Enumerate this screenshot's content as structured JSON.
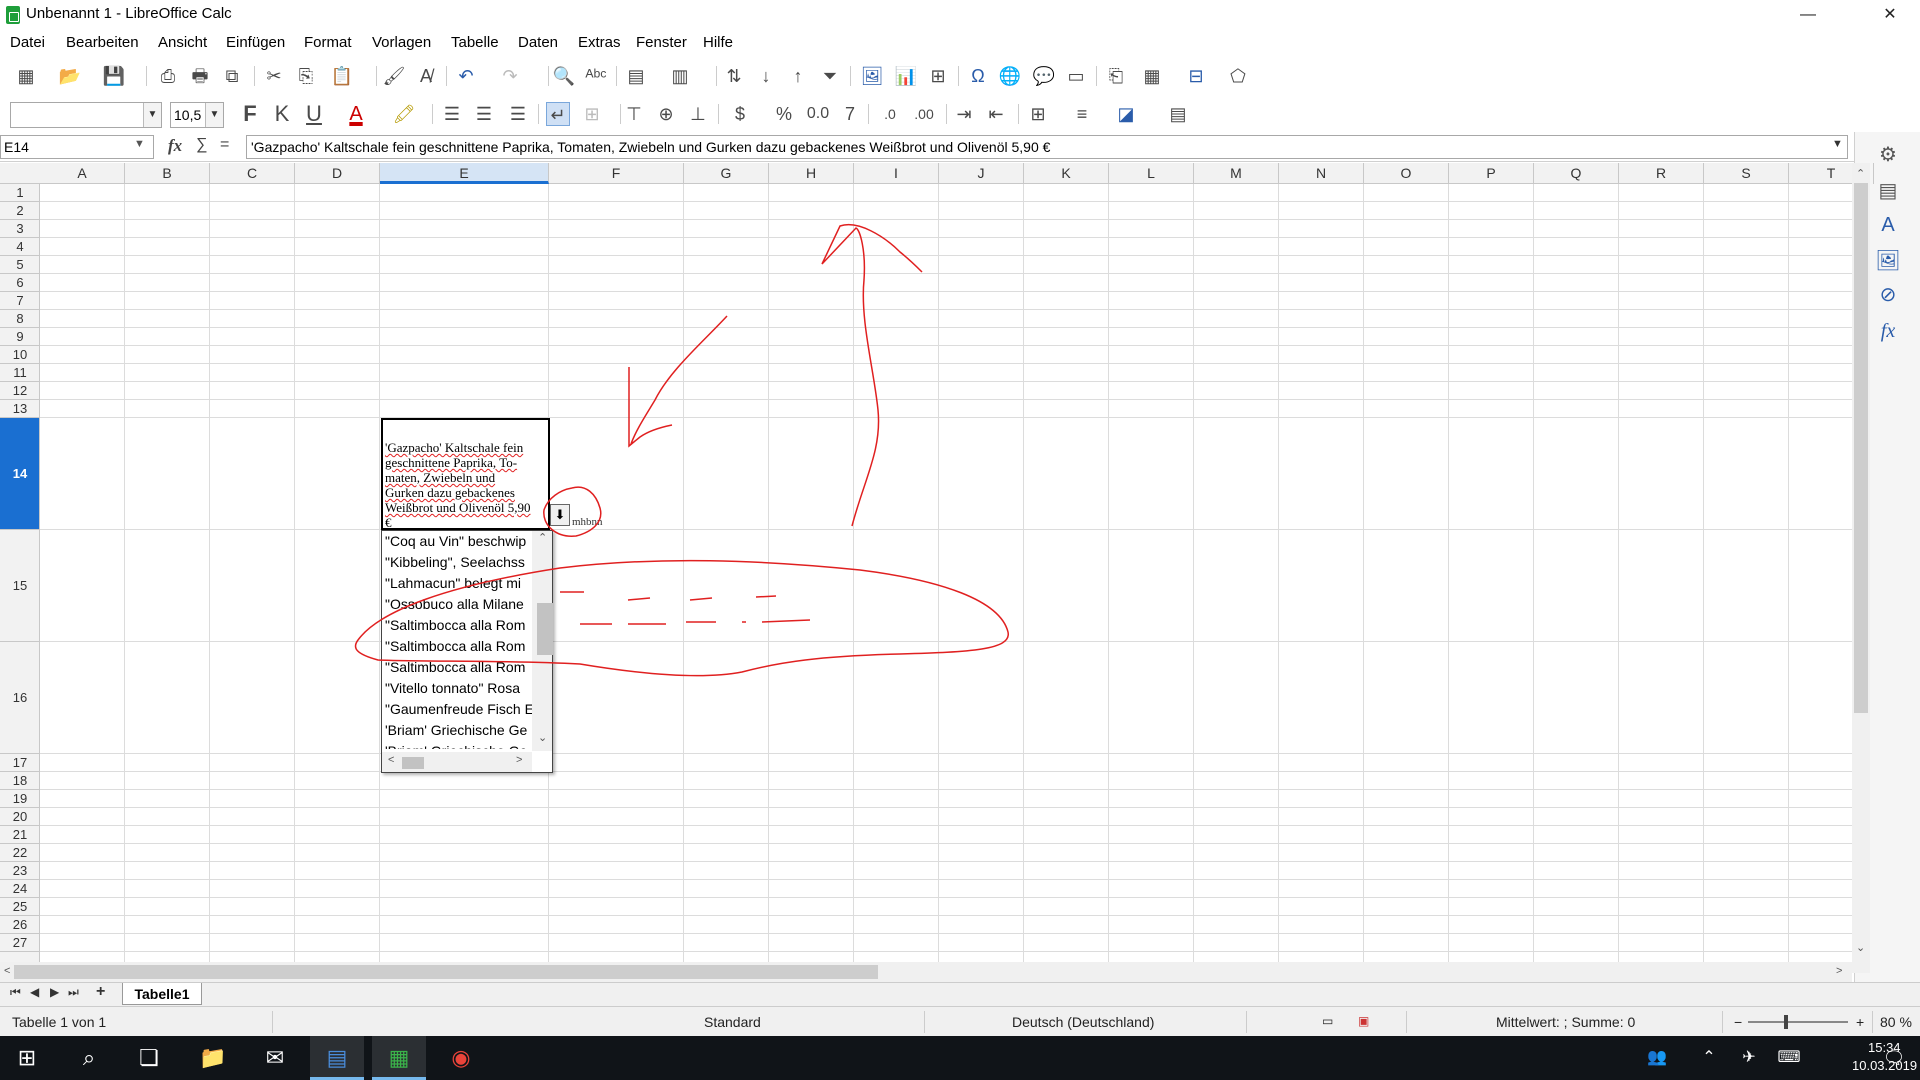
{
  "window": {
    "title": "Unbenannt 1 - LibreOffice Calc",
    "controls": [
      "—",
      "❐",
      "✕"
    ]
  },
  "menu": [
    "Datei",
    "Bearbeiten",
    "Ansicht",
    "Einfügen",
    "Format",
    "Vorlagen",
    "Tabelle",
    "Daten",
    "Extras",
    "Fenster",
    "Hilfe"
  ],
  "format_toolbar": {
    "font_name": "",
    "font_size": "10,5",
    "bold": "F",
    "italic": "K",
    "underline": "U",
    "currency": "$",
    "percent": "%",
    "number": "0.0",
    "decimals_add": ".0",
    "decimals_del": ".00"
  },
  "formula_bar": {
    "name_box": "E14",
    "fx": "fx",
    "sum": "∑",
    "equals": "=",
    "content": "'Gazpacho' Kaltschale fein geschnittene Paprika, Tomaten, Zwiebeln und Gurken dazu gebackenes Weißbrot und Olivenöl         5,90 €"
  },
  "columns": [
    "A",
    "B",
    "C",
    "D",
    "E",
    "F",
    "G",
    "H",
    "I",
    "J",
    "K",
    "L",
    "M",
    "N",
    "O",
    "P",
    "Q",
    "R",
    "S",
    "T"
  ],
  "selected_column": "E",
  "rows": [
    "1",
    "2",
    "3",
    "4",
    "5",
    "6",
    "7",
    "8",
    "9",
    "10",
    "11",
    "12",
    "13",
    "14",
    "15",
    "16",
    "17",
    "18",
    "19",
    "20",
    "21",
    "22",
    "23",
    "24",
    "25",
    "26",
    "27"
  ],
  "selected_row": "14",
  "active_cell": {
    "lines": [
      "'Gazpacho' Kaltschale fein",
      "geschnittene Paprika, To-",
      "maten, Zwiebeln und",
      "Gurken dazu gebackenes",
      "Weißbrot und Olivenöl  5,90",
      "€"
    ]
  },
  "ghost_text": "mhbnn",
  "dropdown_list": [
    "\"Coq au Vin\" beschwip",
    "\"Kibbeling\", Seelachss",
    "\"Lahmacun\" belegt mi",
    "\"Ossobuco alla Milane",
    "\"Saltimbocca alla Rom",
    "\"Saltimbocca alla Rom",
    "\"Saltimbocca alla Rom",
    "\"Vitello tonnato\" Rosa",
    "\"Gaumenfreude Fisch E",
    "'Briam' Griechische Ge",
    "'Briam' Griechische Ge"
  ],
  "sheet_tabs": {
    "nav": [
      "⏮",
      "◀",
      "▶",
      "⏭",
      "+"
    ],
    "active": "Tabelle1"
  },
  "status": {
    "sheet": "Tabelle 1 von 1",
    "style": "Standard",
    "language": "Deutsch (Deutschland)",
    "summary": "Mittelwert: ; Summe: 0",
    "zoom": "80 %"
  },
  "taskbar": {
    "time": "15:34",
    "date": "10.03.2019"
  },
  "colors": {
    "selection_blue": "#1a6fd1",
    "annotation_red": "#e02020"
  }
}
